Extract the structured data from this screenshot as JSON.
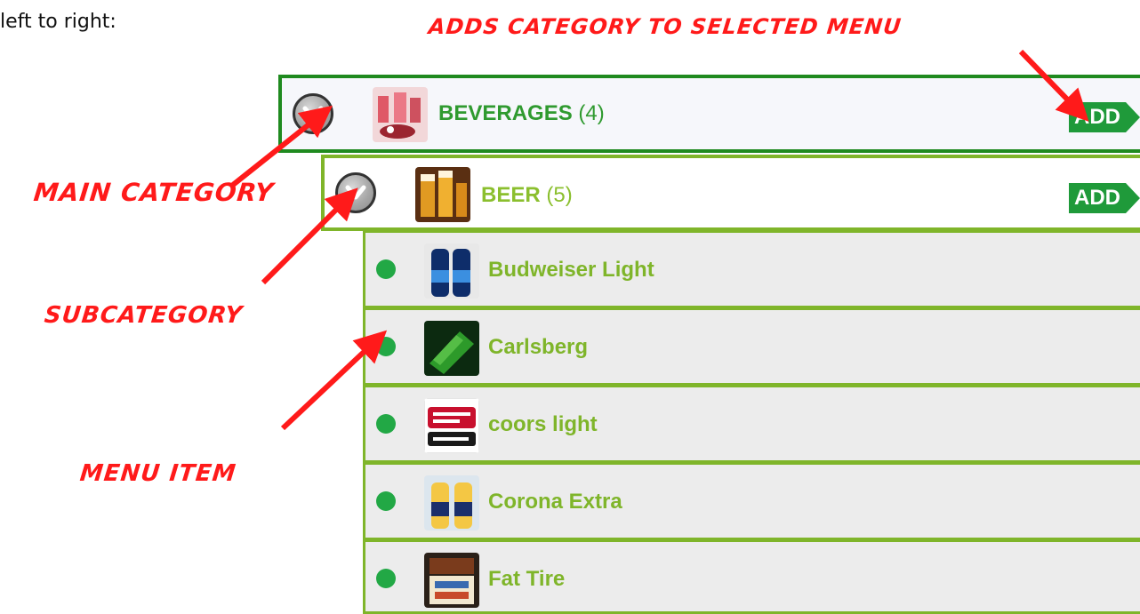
{
  "intro_text": "left to right:",
  "annotations": {
    "add_note": "ADDS CATEGORY TO SELECTED MENU",
    "main_category": "MAIN CATEGORY",
    "subcategory": "SUBCATEGORY",
    "menu_item": "MENU ITEM"
  },
  "colors": {
    "main_border": "#1f8a1f",
    "sub_border": "#7fb52a",
    "add_button": "#1f9a3a",
    "annotation": "#ff1a1a",
    "status_dot": "#22a845"
  },
  "main_category": {
    "name": "BEVERAGES",
    "count": "(4)",
    "add_label": "ADD",
    "thumbnail": "beverages-thumbnail"
  },
  "subcategory": {
    "name": "BEER",
    "count": "(5)",
    "add_label": "ADD",
    "thumbnail": "beer-thumbnail"
  },
  "menu_items": [
    {
      "name": "Budweiser Light",
      "thumbnail": "budweiser-thumbnail"
    },
    {
      "name": "Carlsberg",
      "thumbnail": "carlsberg-thumbnail"
    },
    {
      "name": "coors light",
      "thumbnail": "coors-thumbnail"
    },
    {
      "name": "Corona Extra",
      "thumbnail": "corona-thumbnail"
    },
    {
      "name": "Fat Tire",
      "thumbnail": "fat-tire-thumbnail"
    }
  ]
}
